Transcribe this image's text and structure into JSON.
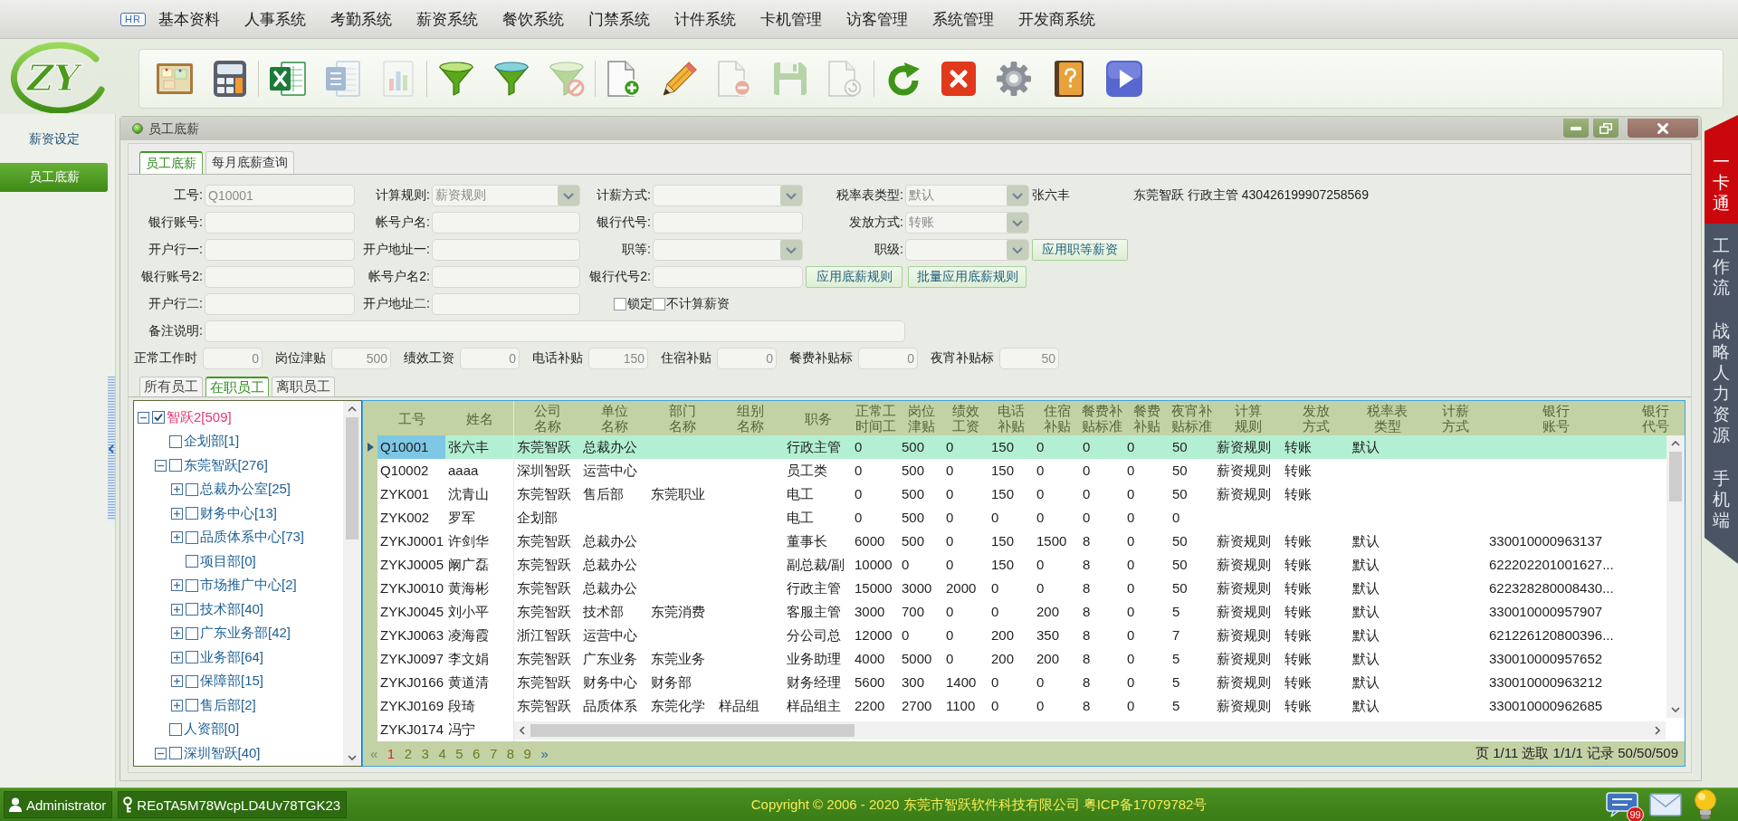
{
  "logo": {
    "text": "ZY"
  },
  "menu": {
    "badge": "HR",
    "items": [
      "基本资料",
      "人事系统",
      "考勤系统",
      "薪资系统",
      "餐饮系统",
      "门禁系统",
      "计件系统",
      "卡机管理",
      "访客管理",
      "系统管理",
      "开发商系统"
    ]
  },
  "toolbar": {
    "groups": [
      [
        {
          "disabled": false
        },
        {
          "disabled": false
        }
      ],
      [
        {
          "disabled": false
        },
        {
          "disabled": true
        },
        {
          "disabled": true
        }
      ],
      [
        {
          "disabled": false
        },
        {
          "disabled": false
        },
        {
          "disabled": true
        }
      ],
      [
        {
          "disabled": false
        },
        {
          "disabled": false
        },
        {
          "disabled": true
        },
        {
          "disabled": true
        },
        {
          "disabled": true
        }
      ],
      [
        {
          "disabled": false
        },
        {
          "disabled": false
        },
        {
          "disabled": false
        },
        {
          "disabled": false
        },
        {
          "disabled": false
        }
      ]
    ]
  },
  "sidebar": {
    "items": [
      {
        "label": "薪资设定",
        "selected": false
      },
      {
        "label": "员工底薪",
        "selected": true
      }
    ]
  },
  "window": {
    "title": "员工底薪",
    "tabs": [
      {
        "label": "员工底薪",
        "selected": true
      },
      {
        "label": "每月底薪查询",
        "selected": false
      }
    ],
    "form": {
      "rows": [
        [
          {
            "kind": "input",
            "label": "工号:",
            "value": "Q10001"
          },
          {
            "kind": "select",
            "label": "计算规则:",
            "value": "薪资规则"
          },
          {
            "kind": "select",
            "label": "计薪方式:"
          },
          {
            "kind": "select",
            "label": "税率表类型:",
            "value": "默认"
          },
          {
            "kind": "text",
            "text": "张六丰"
          },
          {
            "kind": "text",
            "text": "东莞智跃 行政主管 430426199907258569"
          }
        ],
        [
          {
            "kind": "input",
            "label": "银行账号:"
          },
          {
            "kind": "input",
            "label": "帐号户名:"
          },
          {
            "kind": "input",
            "label": "银行代号:"
          },
          {
            "kind": "select",
            "label": "发放方式:",
            "value": "转账"
          }
        ],
        [
          {
            "kind": "input",
            "label": "开户行一:"
          },
          {
            "kind": "input",
            "label": "开户地址一:"
          },
          {
            "kind": "select",
            "label": "职等:"
          },
          {
            "kind": "select",
            "label": "职级:"
          },
          {
            "kind": "button",
            "label": "应用职等薪资"
          }
        ],
        [
          {
            "kind": "input",
            "label": "银行账号2:"
          },
          {
            "kind": "input",
            "label": "帐号户名2:"
          },
          {
            "kind": "input",
            "label": "银行代号2:"
          },
          {
            "kind": "button",
            "label": "应用底薪规则"
          },
          {
            "kind": "button",
            "label": "批量应用底薪规则"
          }
        ],
        [
          {
            "kind": "input",
            "label": "开户行二:"
          },
          {
            "kind": "input",
            "label": "开户地址二:"
          },
          {
            "kind": "checkbox",
            "label": "锁定",
            "checked": false
          },
          {
            "kind": "checkbox",
            "label": "不计算薪资",
            "checked": false
          }
        ],
        [
          {
            "kind": "wide_input",
            "label": "备注说明:"
          }
        ]
      ],
      "amounts": [
        {
          "label": "正常工作时",
          "value": "0"
        },
        {
          "label": "岗位津贴",
          "value": "500"
        },
        {
          "label": "绩效工资",
          "value": "0"
        },
        {
          "label": "电话补贴",
          "value": "150"
        },
        {
          "label": "住宿补贴",
          "value": "0"
        },
        {
          "label": "餐费补贴标",
          "value": "0"
        },
        {
          "label": "夜宵补贴标",
          "value": "50"
        }
      ]
    },
    "employee_tabs": [
      {
        "label": "所有员工",
        "selected": false
      },
      {
        "label": "在职员工",
        "selected": true
      },
      {
        "label": "离职员工",
        "selected": false
      }
    ],
    "tree": [
      {
        "label": "智跃2[509]",
        "kind": "group",
        "expanded": true,
        "checked": true,
        "selected": true,
        "children": [
          {
            "label": "企划部[1]",
            "kind": "leaf",
            "checked": false,
            "selected": false
          },
          {
            "label": "东莞智跃[276]",
            "kind": "group",
            "expanded": true,
            "checked": false,
            "selected": false,
            "children": [
              {
                "label": "总裁办公室[25]",
                "kind": "group",
                "expanded": false,
                "checked": false,
                "selected": false
              },
              {
                "label": "财务中心[13]",
                "kind": "group",
                "expanded": false,
                "checked": false,
                "selected": false
              },
              {
                "label": "品质体系中心[73]",
                "kind": "group",
                "expanded": false,
                "checked": false,
                "selected": false
              },
              {
                "label": "项目部[0]",
                "kind": "leaf",
                "checked": false,
                "selected": false
              },
              {
                "label": "市场推广中心[2]",
                "kind": "group",
                "expanded": false,
                "checked": false,
                "selected": false
              },
              {
                "label": "技术部[40]",
                "kind": "group",
                "expanded": false,
                "checked": false,
                "selected": false
              },
              {
                "label": "广东业务部[42]",
                "kind": "group",
                "expanded": false,
                "checked": false,
                "selected": false
              },
              {
                "label": "业务部[64]",
                "kind": "group",
                "expanded": false,
                "checked": false,
                "selected": false
              },
              {
                "label": "保障部[15]",
                "kind": "group",
                "expanded": false,
                "checked": false,
                "selected": false
              },
              {
                "label": "售后部[2]",
                "kind": "group",
                "expanded": false,
                "checked": false,
                "selected": false
              }
            ]
          },
          {
            "label": "人资部[0]",
            "kind": "leaf",
            "checked": false,
            "selected": false
          },
          {
            "label": "深圳智跃[40]",
            "kind": "group",
            "expanded": true,
            "checked": false,
            "selected": false
          }
        ]
      }
    ],
    "table": {
      "columns": [
        "工号",
        "姓名",
        "公司名称",
        "单位名称",
        "部门名称",
        "组别名称",
        "职务",
        "正常工时间工",
        "岗位津贴",
        "绩效工资",
        "电话补贴",
        "住宿补贴",
        "餐费补贴标准",
        "餐费补贴",
        "夜宵补贴标准",
        "计算规则",
        "发放方式",
        "税率表类型",
        "计薪方式",
        "银行账号",
        "银行代号"
      ],
      "rows": [
        {
          "selected": true,
          "cells": [
            "Q10001",
            "张六丰",
            "东莞智跃",
            "总裁办公",
            null,
            null,
            "行政主管",
            "0",
            "500",
            "0",
            "150",
            "0",
            "0",
            "0",
            "50",
            "薪资规则",
            "转账",
            "默认"
          ]
        },
        {
          "selected": false,
          "cells": [
            "Q10002",
            "aaaa",
            "深圳智跃",
            "运营中心",
            null,
            null,
            "员工类",
            "0",
            "500",
            "0",
            "150",
            "0",
            "0",
            "0",
            "50",
            "薪资规则",
            "转账"
          ]
        },
        {
          "selected": false,
          "cells": [
            "ZYK001",
            "沈青山",
            "东莞智跃",
            "售后部",
            "东莞职业",
            null,
            "电工",
            "0",
            "500",
            "0",
            "150",
            "0",
            "0",
            "0",
            "50",
            "薪资规则",
            "转账"
          ]
        },
        {
          "selected": false,
          "cells": [
            "ZYK002",
            "罗军",
            "企划部",
            null,
            null,
            null,
            "电工",
            "0",
            "500",
            "0",
            "0",
            "0",
            "0",
            "0",
            "0"
          ]
        },
        {
          "selected": false,
          "cells": [
            "ZYKJ0001",
            "许剑华",
            "东莞智跃",
            "总裁办公",
            null,
            null,
            "董事长",
            "6000",
            "500",
            "0",
            "150",
            "1500",
            "8",
            "0",
            "50",
            "薪资规则",
            "转账",
            "默认",
            null,
            "330010000963137"
          ]
        },
        {
          "selected": false,
          "cells": [
            "ZYKJ0005",
            "阚广磊",
            "东莞智跃",
            "总裁办公",
            null,
            null,
            "副总裁/副",
            "10000",
            "0",
            "0",
            "150",
            "0",
            "8",
            "0",
            "50",
            "薪资规则",
            "转账",
            "默认",
            null,
            "622202201001627..."
          ]
        },
        {
          "selected": false,
          "cells": [
            "ZYKJ0010",
            "黄海彬",
            "东莞智跃",
            "总裁办公",
            null,
            null,
            "行政主管",
            "15000",
            "3000",
            "2000",
            "0",
            "0",
            "8",
            "0",
            "50",
            "薪资规则",
            "转账",
            "默认",
            null,
            "622328280008430..."
          ]
        },
        {
          "selected": false,
          "cells": [
            "ZYKJ0045",
            "刘小平",
            "东莞智跃",
            "技术部",
            "东莞消费",
            null,
            "客服主管",
            "3000",
            "700",
            "0",
            "0",
            "200",
            "8",
            "0",
            "5",
            "薪资规则",
            "转账",
            "默认",
            null,
            "330010000957907"
          ]
        },
        {
          "selected": false,
          "cells": [
            "ZYKJ0063",
            "凌海霞",
            "浙江智跃",
            "运营中心",
            null,
            null,
            "分公司总",
            "12000",
            "0",
            "0",
            "200",
            "350",
            "8",
            "0",
            "7",
            "薪资规则",
            "转账",
            "默认",
            null,
            "621226120800396..."
          ]
        },
        {
          "selected": false,
          "cells": [
            "ZYKJ0097",
            "李文娟",
            "东莞智跃",
            "广东业务",
            "东莞业务",
            null,
            "业务助理",
            "4000",
            "5000",
            "0",
            "200",
            "200",
            "8",
            "0",
            "5",
            "薪资规则",
            "转账",
            "默认",
            null,
            "330010000957652"
          ]
        },
        {
          "selected": false,
          "cells": [
            "ZYKJ0166",
            "黄道清",
            "东莞智跃",
            "财务中心",
            "财务部",
            null,
            "财务经理",
            "5600",
            "300",
            "1400",
            "0",
            "0",
            "8",
            "0",
            "5",
            "薪资规则",
            "转账",
            "默认",
            null,
            "330010000963212"
          ]
        },
        {
          "selected": false,
          "cells": [
            "ZYKJ0169",
            "段琦",
            "东莞智跃",
            "品质体系",
            "东莞化学",
            "样品组",
            "样品组主",
            "2200",
            "2700",
            "1100",
            "0",
            "0",
            "8",
            "0",
            "5",
            "薪资规则",
            "转账",
            "默认",
            null,
            "330010000962685"
          ]
        },
        {
          "selected": false,
          "cells": [
            "ZYKJ0174",
            "冯宁"
          ]
        }
      ]
    },
    "pager": {
      "prev": {
        "label": "«",
        "disabled": true
      },
      "pages": [
        {
          "label": "1",
          "selected": true
        },
        {
          "label": "2",
          "selected": false
        },
        {
          "label": "3",
          "selected": false
        },
        {
          "label": "4",
          "selected": false
        },
        {
          "label": "5",
          "selected": false
        },
        {
          "label": "6",
          "selected": false
        },
        {
          "label": "7",
          "selected": false
        },
        {
          "label": "8",
          "selected": false
        },
        {
          "label": "9",
          "selected": false
        }
      ],
      "next": {
        "label": "»",
        "disabled": false
      },
      "summary": "页 1/11 选取 1/1/1 记录 50/50/509"
    }
  },
  "side_tabs": [
    {
      "label": "一卡通",
      "selected": true
    },
    {
      "label": "工作流",
      "selected": false
    },
    {
      "label": "战略人力资源",
      "selected": false
    },
    {
      "label": "手机端",
      "selected": false
    }
  ],
  "status_bar": {
    "user": "Administrator",
    "license": "REoTA5M78WcpLD4Uv78TGK23",
    "copyright": "Copyright © 2006 - 2020 东莞市智跃软件科技有限公司 粤ICP备17079782号",
    "message_count": "99"
  }
}
